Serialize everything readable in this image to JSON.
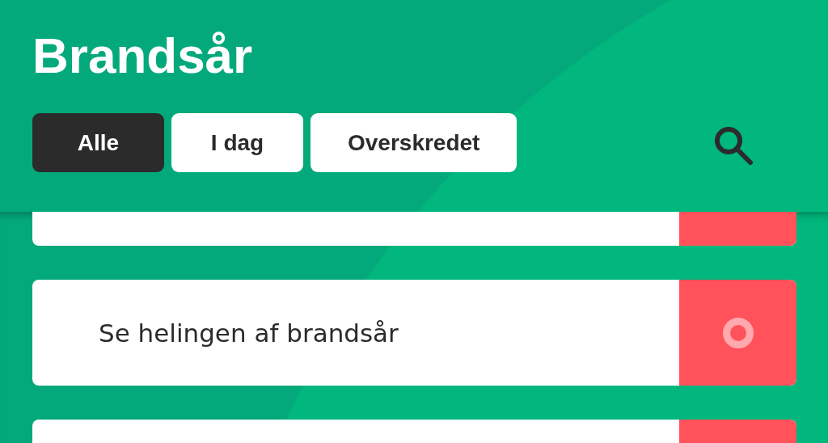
{
  "title": "Brandsår",
  "tabs": [
    {
      "label": "Alle",
      "selected": true
    },
    {
      "label": "I dag",
      "selected": false
    },
    {
      "label": "Overskredet",
      "selected": false
    }
  ],
  "tasks": [
    {
      "done": false
    },
    {
      "text": "Se helingen af brandsår",
      "done": false
    },
    {
      "done": false
    }
  ]
}
